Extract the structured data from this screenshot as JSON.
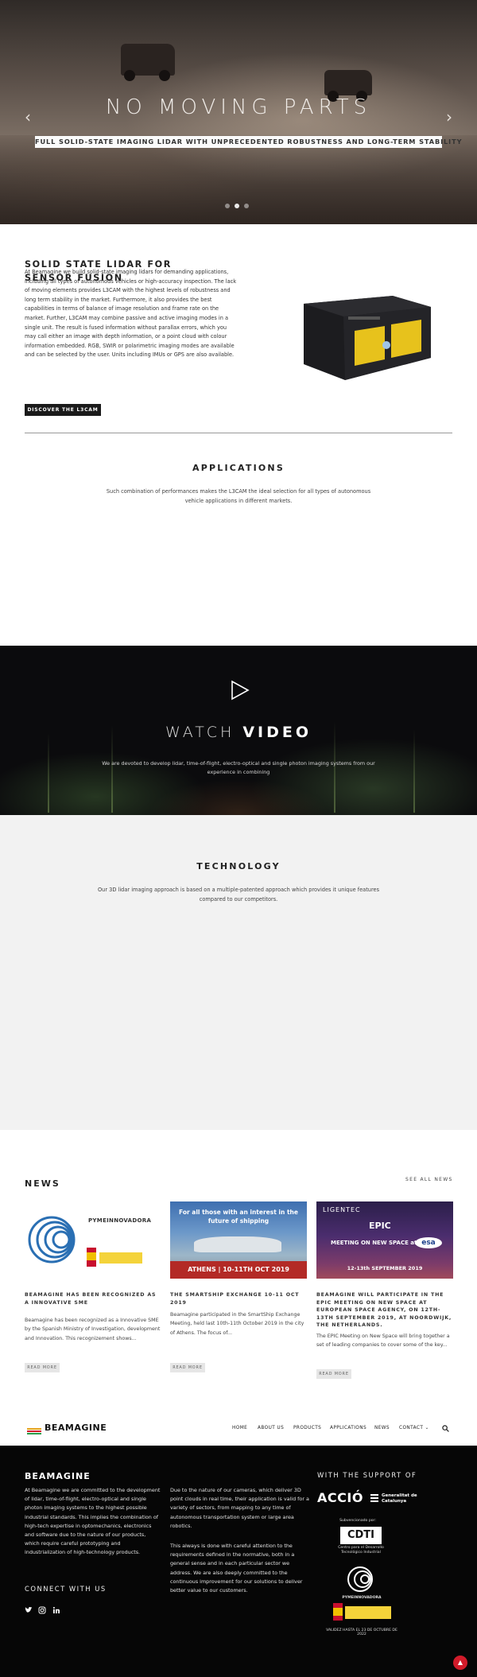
{
  "hero": {
    "title": "NO MOVING PARTS",
    "subtitle": "FULL SOLID-STATE IMAGING LIDAR WITH UNPRECEDENTED ROBUSTNESS AND LONG-TERM STABILITY",
    "prev_arrow": "‹",
    "next_arrow": "›",
    "slides_count": 3,
    "active_slide": 2
  },
  "lidar": {
    "heading": "SOLID STATE LIDAR FOR SENSOR FUSION",
    "paragraph": "At Beamagine we build solid-state imaging lidars for demanding applications, including all types of autonomous vehicles or high-accuracy inspection. The lack of moving elements provides L3CAM with the highest levels of robustness and long term stability in the market. Furthermore, it also provides the best capabilities in terms of balance of image resolution and frame rate on the market. Further, L3CAM may combine passive and active imaging modes in a single unit. The result is fused information without parallax errors, which you may call either an image with depth information, or a point cloud with colour information embedded. RGB, SWIR or polarimetric imaging modes are available and can be selected by the user. Units including IMUs or GPS are also available.",
    "button": "DISCOVER THE L3CAM"
  },
  "applications": {
    "title": "APPLICATIONS",
    "description": "Such combination of performances makes the L3CAM the ideal selection for all types of autonomous vehicle applications in different markets."
  },
  "video": {
    "title_light": "WATCH ",
    "title_bold": "VIDEO",
    "description": "We are devoted to develop lidar, time-of-flight, electro-optical and single photon imaging systems from our experience in combining"
  },
  "technology": {
    "title": "TECHNOLOGY",
    "description": "Our 3D lidar imaging approach is based on a multiple-patented approach which provides it unique features compared to our competitors."
  },
  "news": {
    "title": "NEWS",
    "see_all": "SEE ALL NEWS",
    "items": [
      {
        "image_label": "PYMEINNOVADORA",
        "headline": "BEAMAGINE HAS BEEN RECOGNIZED AS A INNOVATIVE SME",
        "excerpt": "Beamagine has been recognized as a Innovative SME by the Spanish Ministry of Investigation, development and Innovation. This recognizement shows...",
        "button": "READ MORE"
      },
      {
        "image_title": "For all those with an interest in the future of shipping",
        "image_band": "ATHENS | 10-11TH OCT 2019",
        "headline": "THE SMARTSHIP EXCHANGE 10-11 OCT 2019",
        "excerpt": "Beamagine participated in the SmartShip Exchange Meeting, held last 10th-11th October 2019 in the city of Athens. The focus of...",
        "button": "READ MORE"
      },
      {
        "image_brand": "LIGENTEC",
        "image_epic": "EPIC",
        "image_title": "MEETING ON NEW SPACE at",
        "image_esa": "esa",
        "image_dates": "12-13th SEPTEMBER 2019",
        "headline": "BEAMAGINE WILL PARTICIPATE IN THE EPIC MEETING ON NEW SPACE AT EUROPEAN SPACE AGENCY, ON 12TH-13TH SEPTEMBER 2019, AT NOORDWIJK, THE NETHERLANDS.",
        "excerpt": "The EPIC Meeting on New Space will bring together a set of leading companies to cover some of the key...",
        "button": "READ MORE"
      }
    ]
  },
  "nav": {
    "logo": "BEAMAGINE",
    "items": [
      "HOME",
      "ABOUT US",
      "PRODUCTS",
      "APPLICATIONS",
      "NEWS",
      "CONTACT ⌄"
    ],
    "search_icon": "search-icon"
  },
  "footer": {
    "logo": "BEAMAGINE",
    "col1": "At Beamagine we are committed to the development of lidar, time-of-flight, electro-optical and single photon imaging systems to the highest possible industrial standards. This implies the combination of high-tech expertise in optomechanics, electronics and software due to the nature of our products, which require careful prototyping and industrialization of high-technology products.",
    "col2a": "Due to the nature of our cameras, which deliver 3D point clouds in real time, their application is valid for a variety of sectors, from mapping to any time of autonomous transportation system or large area robotics.",
    "col2b": "This always is done with careful attention to the requirements defined in the normative, both in a general sense and in each particular sector we address. We are also deeply committed to the continuous improvement for our solutions to deliver better value to our customers.",
    "connect": "CONNECT WITH US",
    "support": "WITH THE SUPPORT OF",
    "accio": "ACCIÓ",
    "generalitat": "Generalitat de Catalunya",
    "subvencionado": "Subvencionado por:",
    "cdti": "CDTI",
    "cdti_sub": "Centro para el Desarrollo Tecnológico Industrial",
    "pyme": "PYMEINNOVADORA",
    "validez": "VALIDEZ HASTA EL 23 DE OCTUBRE DE 2022",
    "to_top": "▲",
    "colors": {
      "accent": "#d11b2a",
      "dark": "#060606"
    }
  }
}
